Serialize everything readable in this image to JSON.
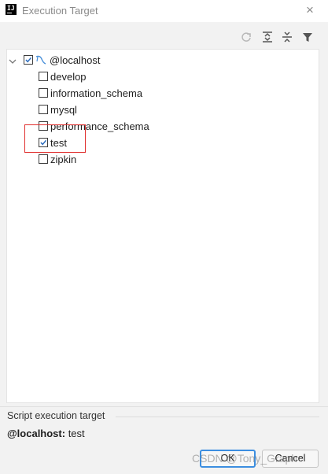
{
  "window": {
    "title": "Execution Target",
    "app_icon_text": "IJ",
    "close_glyph": "×"
  },
  "toolbar": {
    "buttons": [
      {
        "name": "refresh",
        "icon": "refresh-icon",
        "enabled": false
      },
      {
        "name": "expand-all",
        "icon": "expand-all-icon",
        "enabled": true
      },
      {
        "name": "collapse-all",
        "icon": "collapse-all-icon",
        "enabled": true
      },
      {
        "name": "filter",
        "icon": "filter-icon",
        "enabled": true
      }
    ]
  },
  "tree": {
    "root": {
      "label": "@localhost",
      "checked": true,
      "expanded": true,
      "icon": "datasource-icon"
    },
    "schemas": [
      {
        "label": "develop",
        "checked": false
      },
      {
        "label": "information_schema",
        "checked": false
      },
      {
        "label": "mysql",
        "checked": false
      },
      {
        "label": "performance_schema",
        "checked": false
      },
      {
        "label": "test",
        "checked": true
      },
      {
        "label": "zipkin",
        "checked": false
      }
    ]
  },
  "footer": {
    "section_title": "Script execution target",
    "target_host": "@localhost:",
    "target_schema": " test",
    "ok_label": "OK",
    "cancel_label": "Cancel",
    "watermark": "CSDN @Tony_Graph"
  },
  "colors": {
    "accent": "#3c8ee0",
    "highlight": "#e0302f",
    "datasource_icon": "#4a90d9"
  }
}
